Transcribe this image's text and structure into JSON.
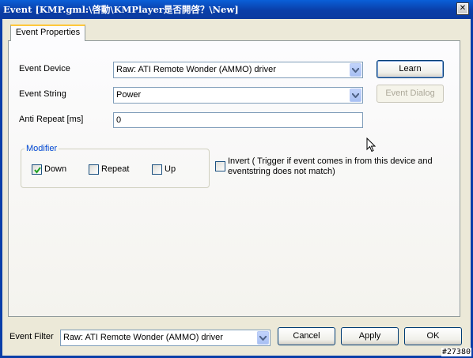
{
  "window": {
    "title": "Event [KMP.gml:\\啓動\\KMPlayer是否開啓？\\New]",
    "close_glyph": "✕"
  },
  "tabs": [
    {
      "label": "Event Properties",
      "active": true
    }
  ],
  "form": {
    "event_device_label": "Event Device",
    "event_device_value": "Raw: ATI Remote Wonder (AMMO) driver",
    "event_string_label": "Event String",
    "event_string_value": "Power",
    "anti_repeat_label": "Anti Repeat [ms]",
    "anti_repeat_value": "0"
  },
  "buttons": {
    "learn": "Learn",
    "event_dialog": "Event Dialog",
    "cancel": "Cancel",
    "apply": "Apply",
    "ok": "OK"
  },
  "modifier": {
    "legend": "Modifier",
    "down": {
      "label": "Down",
      "checked": true
    },
    "repeat": {
      "label": "Repeat",
      "checked": false
    },
    "up": {
      "label": "Up",
      "checked": false
    }
  },
  "invert": {
    "line1": "Invert ( Trigger if event comes in from this device and",
    "line2": "eventstring does not match)",
    "checked": false
  },
  "footer": {
    "event_filter_label": "Event Filter",
    "event_filter_value": "Raw: ATI Remote Wonder (AMMO) driver"
  },
  "watermark": "#27380",
  "colors": {
    "title_bar": "#0A3EA8",
    "accent_tab": "#FFC83C",
    "modifier_legend": "#0046D5"
  }
}
